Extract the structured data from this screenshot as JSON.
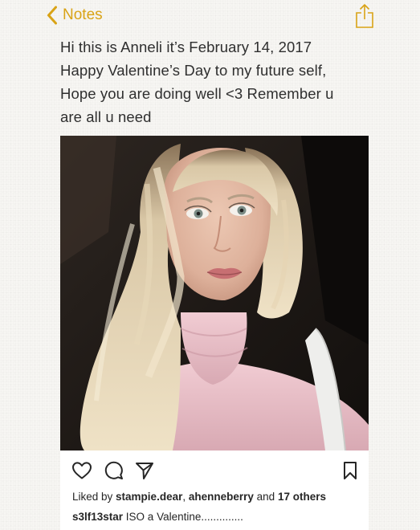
{
  "nav": {
    "back_label": "Notes",
    "accent_color": "#d9a316",
    "back_icon": "chevron-left-icon",
    "share_icon": "share-icon"
  },
  "note": {
    "lines": [
      "Hi this is Anneli it’s February 14, 2017",
      "Happy Valentine’s Day to my future self,",
      "Hope you are doing well <3 Remember u",
      "are all u need"
    ]
  },
  "post": {
    "photo_icon": "portrait-photo",
    "action_icons": [
      "heart-icon",
      "comment-icon",
      "send-icon",
      "bookmark-icon"
    ],
    "likes_prefix": "Liked by ",
    "liked_user": "stampie.dear",
    "likes_sep": ", ",
    "liked_user2": "ahenneberry",
    "likes_and": " and ",
    "likes_others": "17 others",
    "caption_user": "s3lf13star",
    "caption_text": " ISO a Valentine.............."
  }
}
